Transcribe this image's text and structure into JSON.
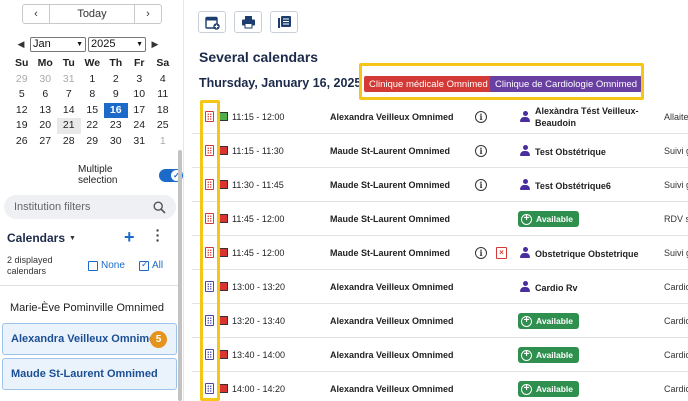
{
  "nav": {
    "prev": "‹",
    "today": "Today",
    "next": "›"
  },
  "minical": {
    "prev_arrow": "◀",
    "next_arrow": "▶",
    "month": "Jan",
    "year": "2025",
    "weekdays": [
      "Su",
      "Mo",
      "Tu",
      "We",
      "Th",
      "Fr",
      "Sa"
    ],
    "weeks": [
      [
        "29",
        "30",
        "31",
        "1",
        "2",
        "3",
        "4"
      ],
      [
        "5",
        "6",
        "7",
        "8",
        "9",
        "10",
        "11"
      ],
      [
        "12",
        "13",
        "14",
        "15",
        "16",
        "17",
        "18"
      ],
      [
        "19",
        "20",
        "21",
        "22",
        "23",
        "24",
        "25"
      ],
      [
        "26",
        "27",
        "28",
        "29",
        "30",
        "31",
        "1"
      ]
    ],
    "selected_day": "16",
    "highlighted_day": "21"
  },
  "multiple_selection": {
    "label": "Multiple selection",
    "enabled": true
  },
  "institution_filter": {
    "placeholder": "Institution filters"
  },
  "calendars": {
    "title": "Calendars",
    "add": "+",
    "displayed": "2 displayed calendars",
    "none": "None",
    "all": "All",
    "items": [
      {
        "name": "Marie-Ève Pominville Omnimed",
        "selected": false
      },
      {
        "name": "Alexandra Veilleux Omnimed",
        "selected": true,
        "badge": "5"
      },
      {
        "name": "Maude St-Laurent Omnimed",
        "selected": true
      }
    ]
  },
  "main": {
    "title": "Several calendars",
    "date": "Thursday, January 16, 2025",
    "chips": [
      {
        "label": "Clinique médicale Omnimed",
        "color": "#d33a36"
      },
      {
        "label": "Clinique de Cardiologie Omnimed",
        "color": "#6a3fa2"
      }
    ],
    "available_label": "Available",
    "rows": [
      {
        "cal": "red",
        "status": "green",
        "time": "11:15 - 12:00",
        "doctor": "Alexandra Veilleux Omnimed",
        "info": true,
        "patient": "Alexàndra Tést Veilleux-Beaudoin",
        "type": "Allaite"
      },
      {
        "cal": "red",
        "status": "red",
        "time": "11:15 - 11:30",
        "doctor": "Maude St-Laurent Omnimed",
        "info": true,
        "patient": "Test Obstétrique",
        "type": "Suivi g"
      },
      {
        "cal": "red",
        "status": "red",
        "time": "11:30 - 11:45",
        "doctor": "Maude St-Laurent Omnimed",
        "info": true,
        "patient": "Test Obstétrique6",
        "type": "Suivi g"
      },
      {
        "cal": "red",
        "status": "red",
        "time": "11:45 - 12:00",
        "doctor": "Maude St-Laurent Omnimed",
        "available": true,
        "type": "RDV s"
      },
      {
        "cal": "red",
        "status": "red",
        "time": "11:45 - 12:00",
        "doctor": "Maude St-Laurent Omnimed",
        "info": true,
        "delete": true,
        "patient": "Obstetrique Obstetrique",
        "type": "Suivi g"
      },
      {
        "cal": "blue",
        "status": "red",
        "time": "13:00 - 13:20",
        "doctor": "Alexandra Veilleux Omnimed",
        "patient": "Cardio Rv",
        "type": "Cardio"
      },
      {
        "cal": "blue",
        "status": "red",
        "time": "13:20 - 13:40",
        "doctor": "Alexandra Veilleux Omnimed",
        "available": true,
        "type": "Cardio"
      },
      {
        "cal": "blue",
        "status": "red",
        "time": "13:40 - 14:00",
        "doctor": "Alexandra Veilleux Omnimed",
        "available": true,
        "type": "Cardio"
      },
      {
        "cal": "blue",
        "status": "red",
        "time": "14:00 - 14:20",
        "doctor": "Alexandra Veilleux Omnimed",
        "available": true,
        "type": "Cardio"
      }
    ]
  }
}
